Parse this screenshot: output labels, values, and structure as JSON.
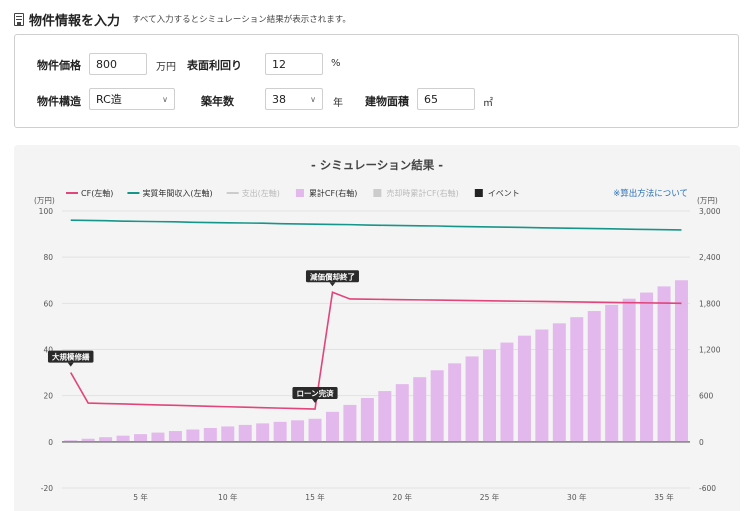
{
  "header": {
    "title": "物件情報を入力",
    "note": "すべて入力するとシミュレーション結果が表示されます。",
    "icon": "building-icon"
  },
  "form": {
    "price": {
      "label": "物件価格",
      "value": "800",
      "unit": "万円"
    },
    "yield": {
      "label": "表面利回り",
      "value": "12",
      "unit": "%"
    },
    "structure": {
      "label": "物件構造",
      "value": "RC造"
    },
    "age": {
      "label": "築年数",
      "value": "38",
      "unit": "年"
    },
    "area": {
      "label": "建物面積",
      "value": "65",
      "unit": "㎡"
    }
  },
  "chart_title": "- シミュレーション結果 -",
  "legend": [
    {
      "label": "CF(左軸)",
      "type": "line",
      "color": "#e0457b"
    },
    {
      "label": "実質年間収入(左軸)",
      "type": "line",
      "color": "#16968a"
    },
    {
      "label": "支出(左軸)",
      "type": "line",
      "color": "#cccccc"
    },
    {
      "label": "累計CF(右軸)",
      "type": "box",
      "color": "#e3b8ec"
    },
    {
      "label": "売却時累計CF(右軸)",
      "type": "box",
      "color": "#cccccc"
    },
    {
      "label": "イベント",
      "type": "box",
      "color": "#222222"
    }
  ],
  "calc_link": "※算出方法について",
  "chart_data": {
    "type": "bar",
    "left_axis": {
      "unit": "(万円)",
      "min": -20,
      "max": 100,
      "ticks": [
        100,
        80,
        60,
        40,
        20,
        0,
        -20
      ],
      "tick_labels": [
        "100",
        "80",
        "60",
        "40",
        "20",
        "0",
        "-20"
      ]
    },
    "right_axis": {
      "unit": "(万円)",
      "min": -600,
      "max": 3000,
      "ticks": [
        3000,
        2400,
        1800,
        1200,
        600,
        0,
        -600
      ],
      "tick_labels": [
        "3,000",
        "2,400",
        "1,800",
        "1,200",
        "600",
        "0",
        "-600"
      ]
    },
    "x_ticks": [
      5,
      10,
      15,
      20,
      25,
      30,
      35
    ],
    "x_tick_labels": [
      "5 年",
      "10 年",
      "15 年",
      "20 年",
      "25 年",
      "30 年",
      "35 年"
    ],
    "years": [
      1,
      2,
      3,
      4,
      5,
      6,
      7,
      8,
      9,
      10,
      11,
      12,
      13,
      14,
      15,
      16,
      17,
      18,
      19,
      20,
      21,
      22,
      23,
      24,
      25,
      26,
      27,
      28,
      29,
      30,
      31,
      32,
      33,
      34,
      35,
      36
    ],
    "series": [
      {
        "name": "CF(左軸)",
        "axis": "left",
        "color": "#e0457b",
        "values": [
          30,
          16.8,
          16.6,
          16.4,
          16.2,
          16.0,
          15.8,
          15.6,
          15.4,
          15.2,
          15.0,
          14.8,
          14.6,
          14.4,
          14.2,
          64.8,
          61.9,
          61.8,
          61.7,
          61.6,
          61.5,
          61.4,
          61.3,
          61.2,
          61.1,
          61.0,
          60.9,
          60.8,
          60.7,
          60.6,
          60.5,
          60.4,
          60.3,
          60.2,
          60.1,
          60.0
        ]
      },
      {
        "name": "実質年間収入(左軸)",
        "axis": "left",
        "color": "#16968a",
        "values": [
          96.0,
          95.9,
          95.8,
          95.6,
          95.5,
          95.4,
          95.3,
          95.1,
          95.0,
          94.9,
          94.8,
          94.7,
          94.5,
          94.4,
          94.3,
          94.2,
          94.1,
          93.9,
          93.8,
          93.7,
          93.6,
          93.5,
          93.3,
          93.2,
          93.1,
          93.0,
          92.9,
          92.7,
          92.6,
          92.5,
          92.4,
          92.3,
          92.1,
          92.0,
          91.9,
          91.8
        ]
      },
      {
        "name": "累計CF(右軸)",
        "axis": "right",
        "color": "#e3b8ec",
        "values": [
          20,
          40,
          60,
          80,
          100,
          120,
          140,
          160,
          180,
          200,
          220,
          240,
          260,
          280,
          300,
          390,
          480,
          570,
          660,
          750,
          840,
          930,
          1020,
          1110,
          1200,
          1290,
          1380,
          1460,
          1540,
          1620,
          1700,
          1780,
          1860,
          1940,
          2020,
          2100
        ]
      }
    ],
    "events": [
      {
        "year": 1,
        "label": "大規模修繕",
        "value": 30
      },
      {
        "year": 15,
        "label": "ローン完済",
        "value": 14.2
      },
      {
        "year": 16,
        "label": "減価償却終了",
        "value": 64.8
      }
    ]
  }
}
